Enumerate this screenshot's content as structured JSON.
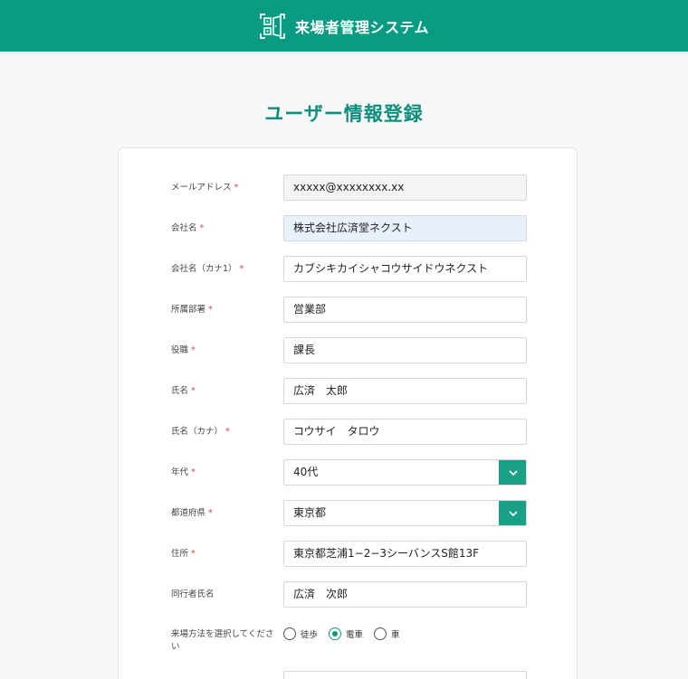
{
  "header": {
    "app_name": "来場者管理システム",
    "icon": "qr-door-icon"
  },
  "page": {
    "title": "ユーザー情報登録"
  },
  "required_mark": "*",
  "form": {
    "email": {
      "label": "メールアドレス",
      "value": "xxxxx@xxxxxxxx.xx"
    },
    "company": {
      "label": "会社名",
      "value": "株式会社広済堂ネクスト"
    },
    "company_kana": {
      "label": "会社名（カナ1）",
      "value": "カブシキカイシャコウサイドウネクスト"
    },
    "department": {
      "label": "所属部署",
      "value": "営業部"
    },
    "position": {
      "label": "役職",
      "value": "課長"
    },
    "name": {
      "label": "氏名",
      "value": "広済　太郎"
    },
    "name_kana": {
      "label": "氏名（カナ）",
      "value": "コウサイ　タロウ"
    },
    "age": {
      "label": "年代",
      "value": "40代"
    },
    "prefecture": {
      "label": "都道府県",
      "value": "東京都"
    },
    "address": {
      "label": "住所",
      "value": "東京都芝浦1−2−3シーバンスS館13F"
    },
    "companion": {
      "label": "同行者氏名",
      "value": "広済　次郎"
    },
    "visit_method": {
      "label": "来場方法を選択してください",
      "options": [
        "徒歩",
        "電車",
        "車"
      ],
      "selected": "電車"
    }
  },
  "colors": {
    "brand": "#0a9c82",
    "title": "#0e8f7c",
    "select_button": "#1aa084",
    "required": "#e0464a"
  }
}
